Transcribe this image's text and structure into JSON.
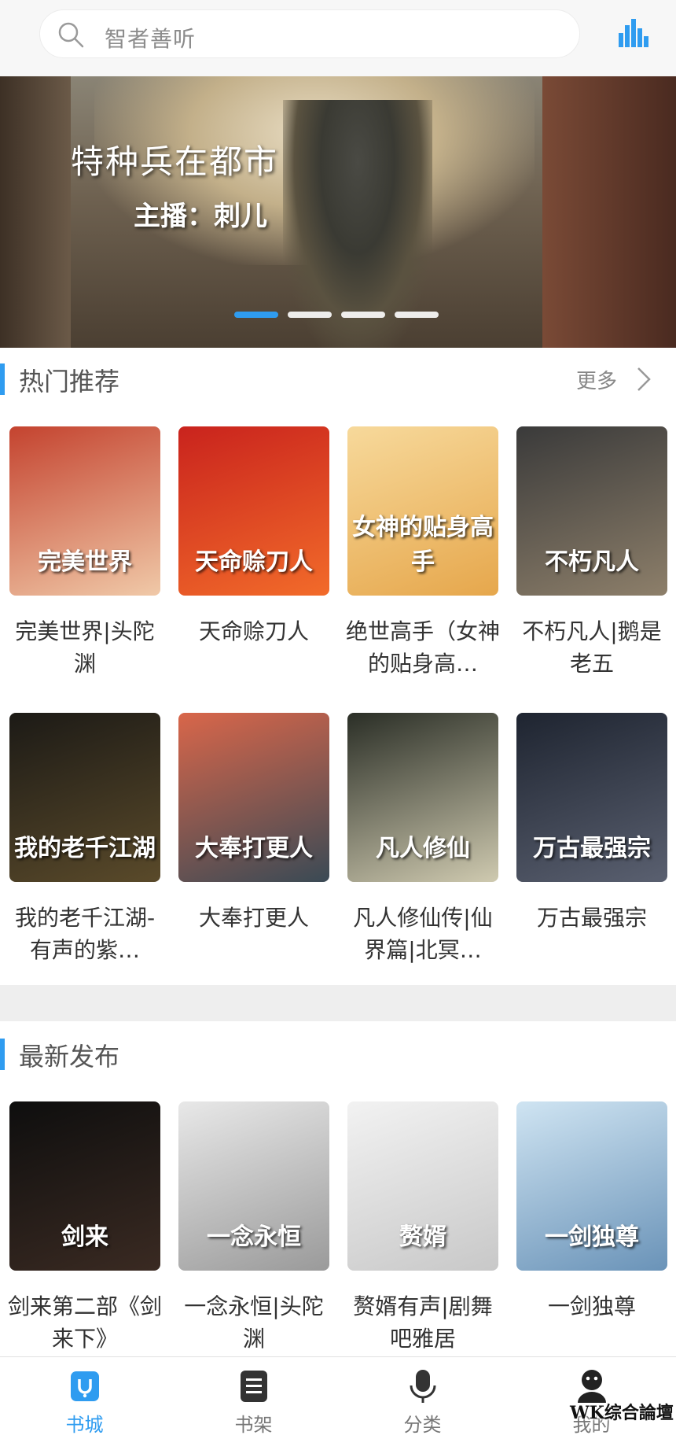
{
  "search": {
    "placeholder": "智者善听"
  },
  "banner": {
    "title": "特种兵在都市",
    "host": "主播：刺儿",
    "slide_count": 4,
    "active_slide": 1
  },
  "sections": [
    {
      "title": "热门推荐",
      "more_label": "更多",
      "books": [
        {
          "name": "完美世界|头陀渊",
          "cover_text": "完美世界",
          "cover_colors": [
            "#c4432f",
            "#f0c9a8"
          ]
        },
        {
          "name": "天命赊刀人",
          "cover_text": "天命赊刀人",
          "cover_colors": [
            "#c9231d",
            "#f26b2a"
          ]
        },
        {
          "name": "绝世高手（女神的贴身高…",
          "cover_text": "女神的贴身高手",
          "cover_colors": [
            "#f7d99b",
            "#e6a74c"
          ]
        },
        {
          "name": "不朽凡人|鹅是老五",
          "cover_text": "不朽凡人",
          "cover_colors": [
            "#3a3a3a",
            "#8d7f6a"
          ]
        },
        {
          "name": "我的老千江湖-有声的紫…",
          "cover_text": "我的老千江湖",
          "cover_colors": [
            "#1c1a16",
            "#5a4a2a"
          ]
        },
        {
          "name": "大奉打更人",
          "cover_text": "大奉打更人",
          "cover_colors": [
            "#d9664a",
            "#3a4a55"
          ]
        },
        {
          "name": "凡人修仙传|仙界篇|北冥…",
          "cover_text": "凡人修仙",
          "cover_colors": [
            "#2a2e26",
            "#cfcab0"
          ]
        },
        {
          "name": "万古最强宗",
          "cover_text": "万古最强宗",
          "cover_colors": [
            "#1e2430",
            "#5a6070"
          ]
        }
      ]
    },
    {
      "title": "最新发布",
      "books": [
        {
          "name": "剑来第二部《剑来下》",
          "cover_text": "剑来",
          "cover_colors": [
            "#0e0e0e",
            "#3a2a22"
          ]
        },
        {
          "name": "一念永恒|头陀渊",
          "cover_text": "一念永恒",
          "cover_colors": [
            "#e8e8e8",
            "#9a9a9a"
          ]
        },
        {
          "name": "赘婿有声|剧舞吧雅居",
          "cover_text": "赘婿",
          "cover_colors": [
            "#f2f2f2",
            "#c8c8c8"
          ]
        },
        {
          "name": "一剑独尊",
          "cover_text": "一剑独尊",
          "cover_colors": [
            "#cfe4f2",
            "#6a93b8"
          ]
        }
      ]
    }
  ],
  "nav": [
    {
      "label": "书城",
      "icon": "store-icon",
      "active": true
    },
    {
      "label": "书架",
      "icon": "bookshelf-icon",
      "active": false
    },
    {
      "label": "分类",
      "icon": "microphone-icon",
      "active": false
    },
    {
      "label": "我的",
      "icon": "user-icon",
      "active": false
    }
  ],
  "watermark": "WK综合論壇",
  "colors": {
    "accent": "#2f9cf0",
    "divider": "#eeeeee"
  }
}
